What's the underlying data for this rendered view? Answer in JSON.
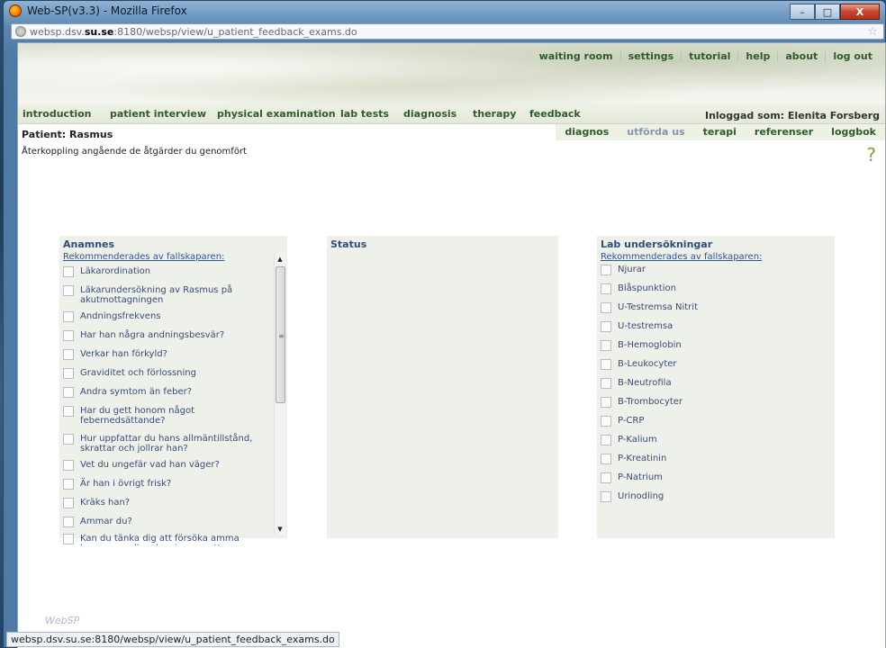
{
  "window": {
    "title": "Web-SP(v3.3) - Mozilla Firefox",
    "controls": {
      "minimize": "–",
      "maximize": "□",
      "close": "X"
    }
  },
  "address": {
    "prefix": "websp.dsv.",
    "host": "su.se",
    "suffix": ":8180/websp/view/u_patient_feedback_exams.do",
    "star": "☆"
  },
  "top_links": [
    "waiting room",
    "settings",
    "tutorial",
    "help",
    "about",
    "log out"
  ],
  "nav": {
    "items": [
      "introduction",
      "patient interview",
      "physical examination",
      "lab tests",
      "diagnosis",
      "therapy",
      "feedback"
    ],
    "login": "Inloggad som: Elenita Forsberg"
  },
  "subtabs": [
    "diagnos",
    "utförda us",
    "terapi",
    "referenser",
    "loggbok"
  ],
  "patient": "Patient: Rasmus",
  "feedback_desc": "Återkoppling angående de åtgärder du genomfört",
  "help_mark": "?",
  "anamnes": {
    "title": "Anamnes",
    "rec_link": "Rekommenderades av fallskaparen:",
    "items": [
      "Läkarordination",
      "Läkarundersökning av Rasmus på akutmottagningen",
      "Andningsfrekvens",
      "Har han några andningsbesvär?",
      "Verkar han förkyld?",
      "Graviditet och förlossning",
      "Andra symtom än feber?",
      "Har du gett honom något febernedsättande?",
      "Hur uppfattar du hans allmäntillstånd, skrattar och jollrar han?",
      "Vet du ungefär vad han väger?",
      "Är han i övrigt frisk?",
      "Kräks han?",
      "Ammar du?",
      "Kan du tänka dig att försöka amma honom nu eller ska vi prova att ge honom lite"
    ],
    "scroll": {
      "up": "▲",
      "down": "▼",
      "grip": "≡"
    }
  },
  "status": {
    "title": "Status"
  },
  "lab": {
    "title": "Lab undersökningar",
    "rec_link": "Rekommenderades av fallskaparen:",
    "items": [
      "Njurar",
      "Blåspunktion",
      "U-Testremsa Nitrit",
      "U-testremsa",
      "B-Hemoglobin",
      "B-Leukocyter",
      "B-Neutrofila",
      "B-Trombocyter",
      "P-CRP",
      "P-Kalium",
      "P-Kreatinin",
      "P-Natrium",
      "Urinodling"
    ]
  },
  "logo": "WebSP",
  "statusbar": "websp.dsv.su.se:8180/websp/view/u_patient_feedback_exams.do",
  "colors": {
    "link_green": "#2e5d2a",
    "panel_bg": "#eef0ea",
    "heading_blue": "#2d4f7c",
    "item_text": "#3b4b7a"
  }
}
